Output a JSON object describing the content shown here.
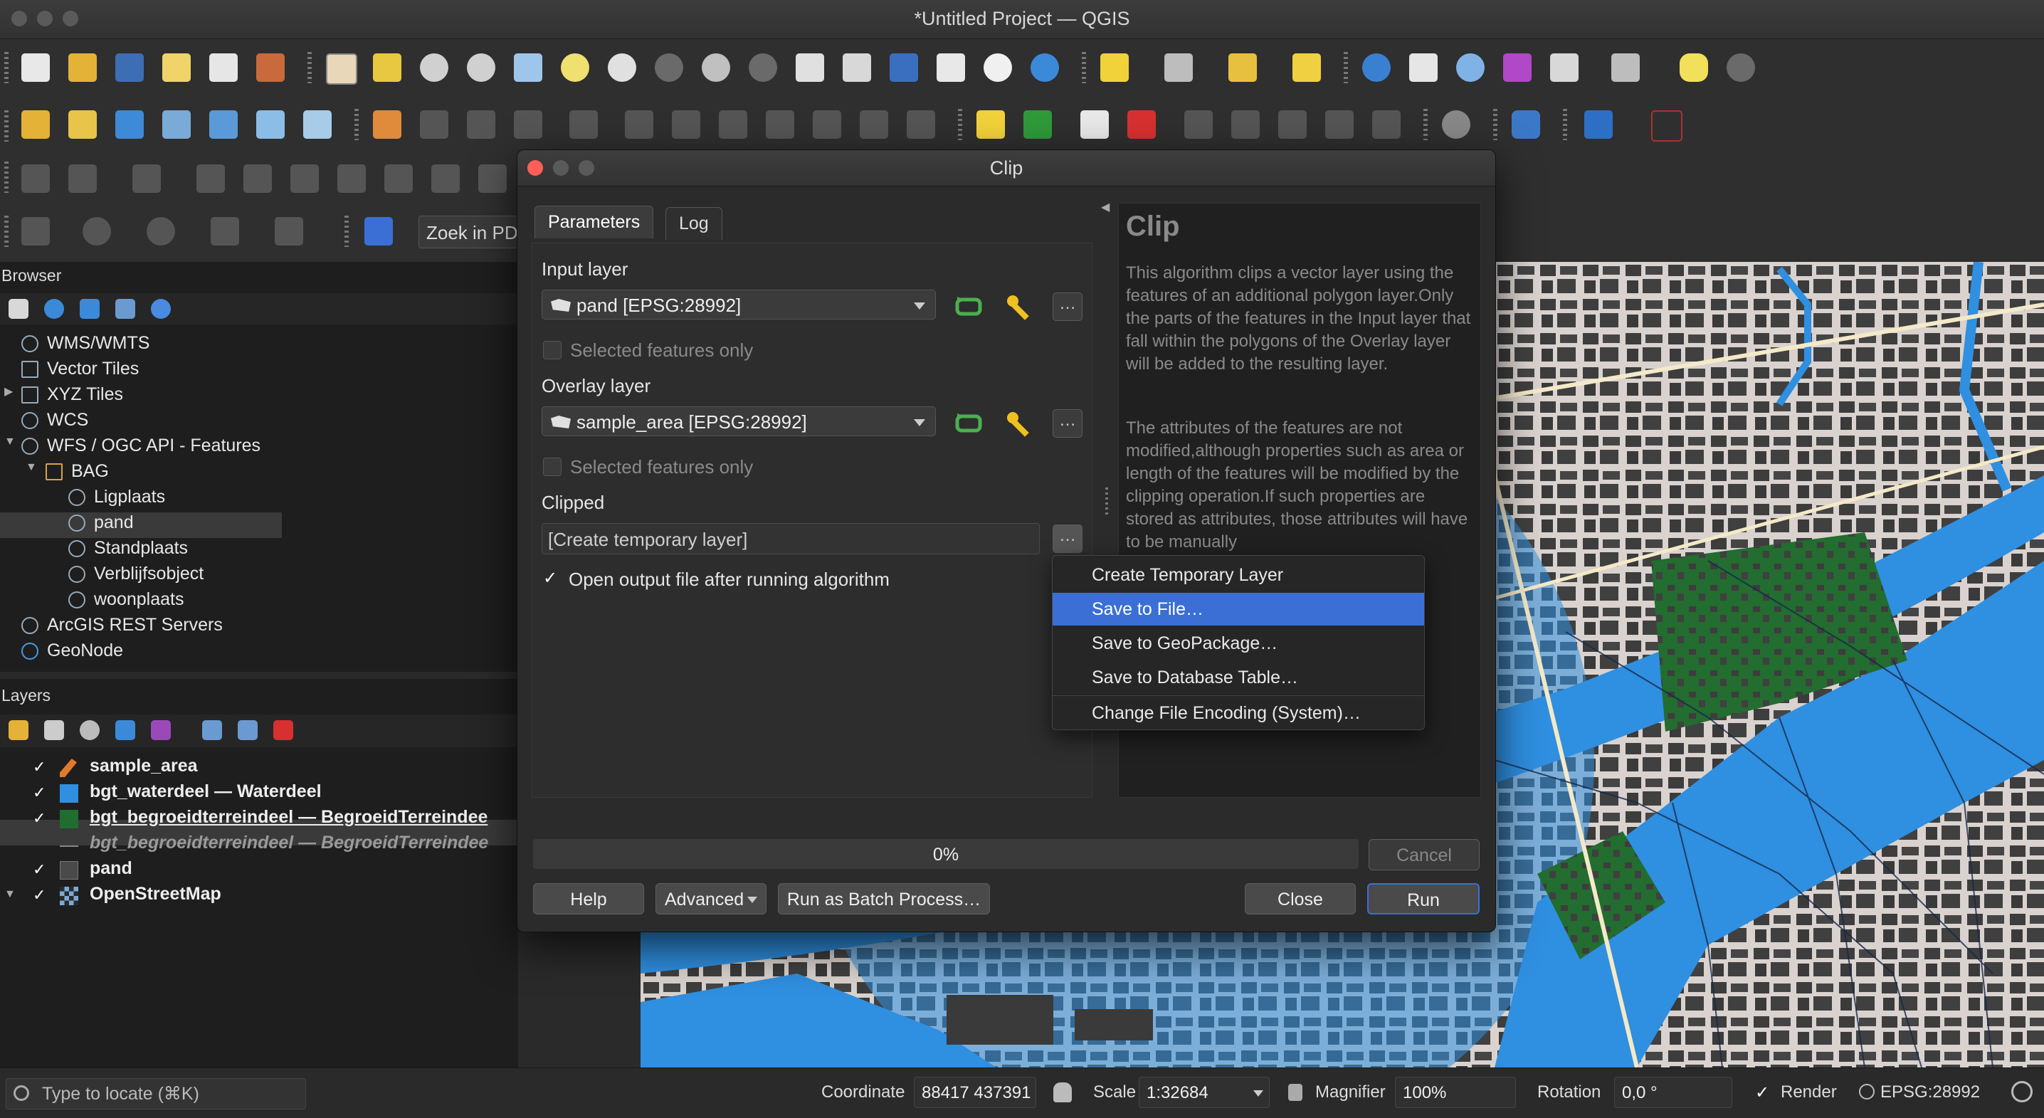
{
  "window": {
    "title": "*Untitled Project — QGIS"
  },
  "toolbar": {
    "search_plugins_placeholder": "Zoek in PD"
  },
  "browser": {
    "header": "Browser",
    "items": [
      {
        "label": "WMS/WMTS",
        "icon": "globe-icon"
      },
      {
        "label": "Vector Tiles",
        "icon": "grid-icon"
      },
      {
        "label": "XYZ Tiles",
        "icon": "grid-icon"
      },
      {
        "label": "WCS",
        "icon": "globe-icon"
      },
      {
        "label": "WFS / OGC API - Features",
        "icon": "globe-icon"
      },
      {
        "label": "BAG",
        "icon": "connection-icon"
      },
      {
        "label": "Ligplaats",
        "icon": "globe-icon"
      },
      {
        "label": "pand",
        "icon": "globe-icon"
      },
      {
        "label": "Standplaats",
        "icon": "globe-icon"
      },
      {
        "label": "Verblijfsobject",
        "icon": "globe-icon"
      },
      {
        "label": "woonplaats",
        "icon": "globe-icon"
      },
      {
        "label": "ArcGIS REST Servers",
        "icon": "arcgis-icon"
      },
      {
        "label": "GeoNode",
        "icon": "geonode-icon"
      }
    ]
  },
  "layers": {
    "header": "Layers",
    "items": [
      {
        "label": "sample_area",
        "checked": true
      },
      {
        "label": "bgt_waterdeel — Waterdeel",
        "checked": true
      },
      {
        "label": "bgt_begroeidterreindeel — BegroeidTerreindee",
        "checked": true
      },
      {
        "label": "bgt_begroeidterreindeel — BegroeidTerreindee",
        "checked": false
      },
      {
        "label": "pand",
        "checked": true
      },
      {
        "label": "OpenStreetMap",
        "checked": true
      }
    ]
  },
  "dialog": {
    "title": "Clip",
    "tabs": [
      "Parameters",
      "Log"
    ],
    "input_layer_label": "Input layer",
    "input_layer_value": "pand [EPSG:28992]",
    "selected_only_label": "Selected features only",
    "overlay_layer_label": "Overlay layer",
    "overlay_layer_value": "sample_area [EPSG:28992]",
    "clipped_label": "Clipped",
    "clipped_value": "[Create temporary layer]",
    "open_output_label": "Open output file after running algorithm",
    "ellipsis": "…",
    "help_title": "Clip",
    "help_p1": "This algorithm clips a vector layer using the features of an additional polygon layer.Only the parts of the features in the Input layer that fall within the polygons of the Overlay layer will be added to the resulting layer.",
    "help_p2": "The attributes of the features are not modified,although properties such as area or length of the features will be modified by the clipping operation.If such properties are stored as attributes, those attributes will have to be manually",
    "progress": "0%",
    "progress_value": 0,
    "buttons": {
      "cancel": "Cancel",
      "help": "Help",
      "advanced": "Advanced",
      "batch": "Run as Batch Process…",
      "close": "Close",
      "run": "Run"
    }
  },
  "menu": {
    "items": [
      "Create Temporary Layer",
      "Save to File…",
      "Save to GeoPackage…",
      "Save to Database Table…",
      "Change File Encoding (System)…"
    ],
    "highlighted_index": 1
  },
  "statusbar": {
    "locate_placeholder": "Type to locate (⌘K)",
    "coordinate_label": "Coordinate",
    "coordinate_value": "88417 437391",
    "scale_label": "Scale",
    "scale_value": "1:32684",
    "magnifier_label": "Magnifier",
    "magnifier_value": "100%",
    "rotation_label": "Rotation",
    "rotation_value": "0,0 °",
    "render_label": "Render",
    "crs_value": "EPSG:28992"
  },
  "colors": {
    "accent": "#3b6fd6",
    "water": "#2f8fe0",
    "green": "#1f6e2f",
    "selection": "#3a3a3a"
  }
}
